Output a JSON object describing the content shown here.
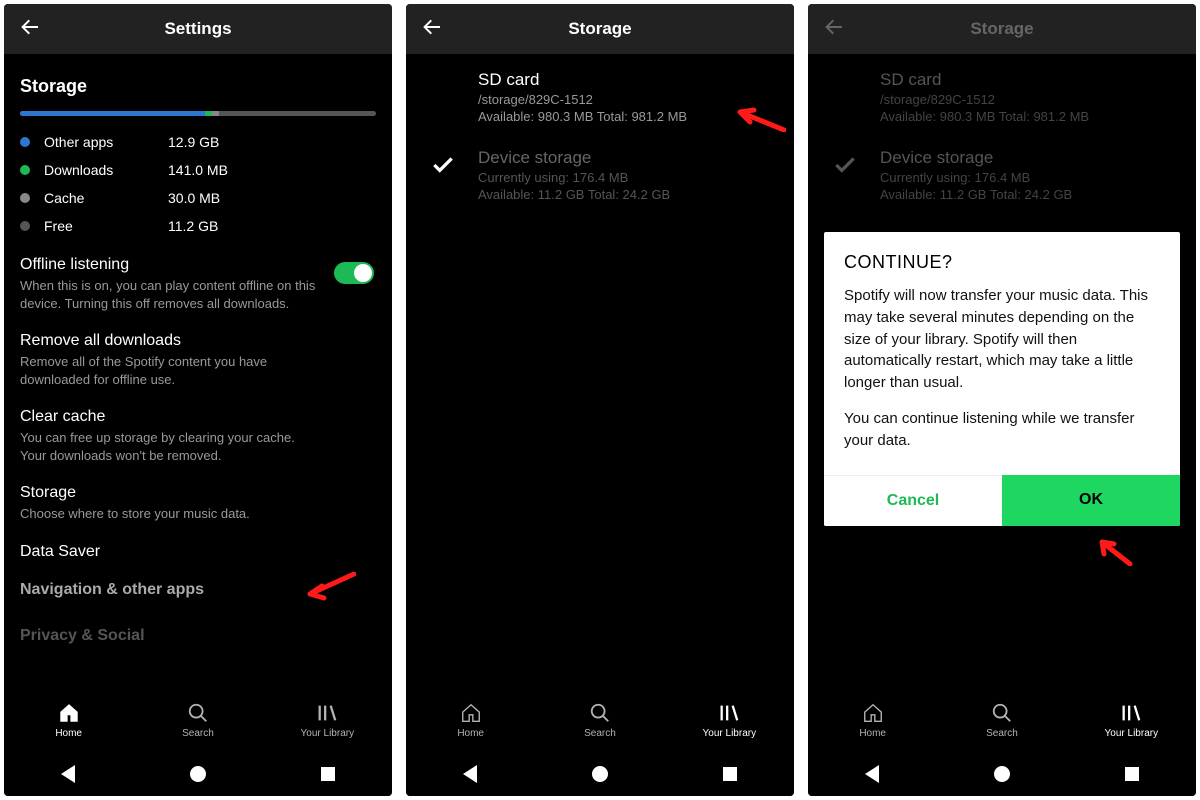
{
  "panel1": {
    "header": "Settings",
    "section": "Storage",
    "bar": {
      "blue_pct": 52,
      "green_pct": 2,
      "grey_pct": 2
    },
    "legend": [
      {
        "color": "blue",
        "label": "Other apps",
        "value": "12.9 GB"
      },
      {
        "color": "green",
        "label": "Downloads",
        "value": "141.0 MB"
      },
      {
        "color": "grey",
        "label": "Cache",
        "value": "30.0 MB"
      },
      {
        "color": "dgrey",
        "label": "Free",
        "value": "11.2 GB"
      }
    ],
    "offline": {
      "title": "Offline listening",
      "desc": "When this is on, you can play content offline on this device. Turning this off removes all downloads."
    },
    "remove": {
      "title": "Remove all downloads",
      "desc": "Remove all of the Spotify content you have downloaded for offline use."
    },
    "clear": {
      "title": "Clear cache",
      "desc": "You can free up storage by clearing your cache. Your downloads won't be removed."
    },
    "storage": {
      "title": "Storage",
      "desc": "Choose where to store your music data."
    },
    "datasaver": "Data Saver",
    "navapps": "Navigation & other apps",
    "privacy": "Privacy & Social"
  },
  "panel2": {
    "header": "Storage",
    "sd": {
      "title": "SD card",
      "path": "/storage/829C-1512",
      "avail": "Available: 980.3 MB Total: 981.2 MB"
    },
    "device": {
      "title": "Device storage",
      "using": "Currently using: 176.4 MB",
      "avail": "Available: 11.2 GB Total: 24.2 GB"
    }
  },
  "panel3": {
    "header": "Storage",
    "sd": {
      "title": "SD card",
      "path": "/storage/829C-1512",
      "avail": "Available: 980.3 MB Total: 981.2 MB"
    },
    "device": {
      "title": "Device storage",
      "using": "Currently using: 176.4 MB",
      "avail": "Available: 11.2 GB Total: 24.2 GB"
    },
    "dialog": {
      "title": "CONTINUE?",
      "body1": "Spotify will now transfer your music data. This may take several minutes depending on the size of your library. Spotify will then automatically restart, which may take a little longer than usual.",
      "body2": "You can continue listening while we transfer your data.",
      "cancel": "Cancel",
      "ok": "OK"
    }
  },
  "tabs": {
    "home": "Home",
    "search": "Search",
    "library": "Your Library"
  }
}
